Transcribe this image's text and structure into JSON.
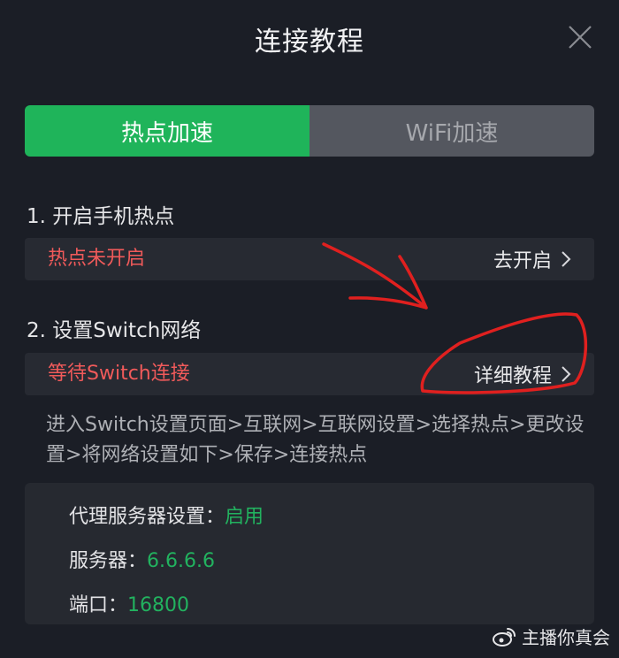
{
  "header": {
    "title": "连接教程"
  },
  "tabs": [
    {
      "label": "热点加速",
      "active": true
    },
    {
      "label": "WiFi加速",
      "active": false
    }
  ],
  "steps": [
    {
      "heading": "1. 开启手机热点",
      "status": "热点未开启",
      "action": "去开启"
    },
    {
      "heading": "2. 设置Switch网络",
      "status": "等待Switch连接",
      "action": "详细教程"
    }
  ],
  "instructions": "进入Switch设置页面>互联网>互联网设置>选择热点>更改设置>将网络设置如下>保存>连接热点",
  "settings": {
    "proxy_label": "代理服务器设置：",
    "proxy_value": "启用",
    "server_label": "服务器：",
    "server_value": "6.6.6.6",
    "port_label": "端口：",
    "port_value": "16800"
  },
  "watermark": {
    "text": "主播你真会"
  },
  "colors": {
    "accent": "#1fb45a",
    "warning": "#f05a5a",
    "annotation": "#e0201f"
  },
  "icons": {
    "close": "close-icon",
    "chevron": "chevron-right-icon",
    "weibo": "weibo-icon"
  }
}
